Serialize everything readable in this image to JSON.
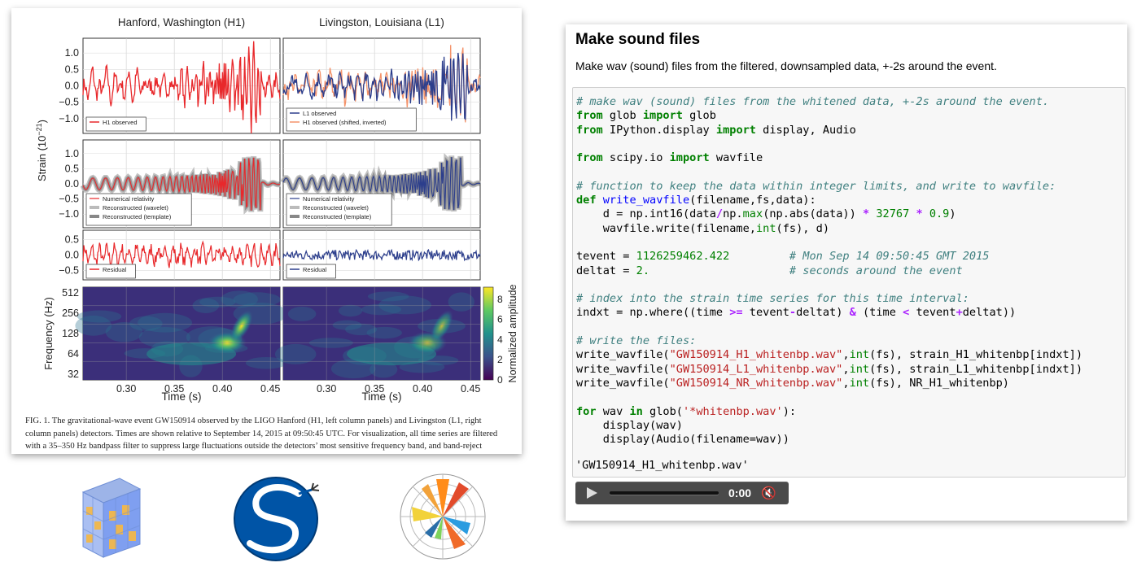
{
  "figure": {
    "titles": [
      "Hanford, Washington (H1)",
      "Livingston, Louisiana (L1)"
    ],
    "ylabel_strain": "Strain (10",
    "ylabel_strain_exp": "−21",
    "ylabel_strain_end": ")",
    "ylabel_freq": "Frequency (Hz)",
    "xlabel": "Time (s)",
    "colorbar_label": "Normalized amplitude",
    "yticks_top": [
      "1.0",
      "0.5",
      "0.0",
      "−0.5",
      "−1.0"
    ],
    "yticks_mid": [
      "1.0",
      "0.5",
      "0.0",
      "−0.5",
      "−1.0"
    ],
    "yticks_res": [
      "0.5",
      "0.0",
      "−0.5"
    ],
    "yticks_freq": [
      "512",
      "256",
      "128",
      "64",
      "32"
    ],
    "xticks": [
      "0.30",
      "0.35",
      "0.40",
      "0.45"
    ],
    "cbar_ticks": [
      "8",
      "6",
      "4",
      "2",
      "0"
    ],
    "legend_h1_top": [
      "H1 observed"
    ],
    "legend_l1_top": [
      "L1 observed",
      "H1 observed (shifted, inverted)"
    ],
    "legend_mid": [
      "Numerical relativity",
      "Reconstructed (wavelet)",
      "Reconstructed (template)"
    ],
    "legend_res": [
      "Residual"
    ],
    "caption_lines": [
      "FIG. 1.   The gravitational-wave event GW150914 observed by the LIGO Hanford (H1, left column panels) and Livingston (L1, right",
      "column panels) detectors. Times are shown relative to September 14, 2015 at 09:50:45 UTC. For visualization, all time series are filtered",
      "with a 35–350 Hz bandpass filter to suppress large fluctuations outside the detectors’ most sensitive frequency band, and band-reject"
    ],
    "colors": {
      "h1": "#e8282b",
      "l1": "#2c3e8c",
      "l1_overlay": "#f4936a"
    }
  },
  "notebook": {
    "heading": "Make sound files",
    "description": "Make wav (sound) files from the filtered, downsampled data, +-2s around the event.",
    "code_lines": [
      "# make wav (sound) files from the whitened data, +-2s around the event.",
      "from glob import glob",
      "from IPython.display import display, Audio",
      "",
      "from scipy.io import wavfile",
      "",
      "# function to keep the data within integer limits, and write to wavfile:",
      "def write_wavfile(filename,fs,data):",
      "    d = np.int16(data/np.max(np.abs(data)) * 32767 * 0.9)",
      "    wavfile.write(filename,int(fs), d)",
      "",
      "tevent = 1126259462.422         # Mon Sep 14 09:50:45 GMT 2015",
      "deltat = 2.                     # seconds around the event",
      "",
      "# index into the strain time series for this time interval:",
      "indxt = np.where((time >= tevent-deltat) & (time < tevent+deltat))",
      "",
      "# write the files:",
      "write_wavfile(\"GW150914_H1_whitenbp.wav\",int(fs), strain_H1_whitenbp[indxt])",
      "write_wavfile(\"GW150914_L1_whitenbp.wav\",int(fs), strain_L1_whitenbp[indxt])",
      "write_wavfile(\"GW150914_NR_whitenbp.wav\",int(fs), NR_H1_whitenbp)",
      "",
      "for wav in glob('*whitenbp.wav'):",
      "    display(wav)",
      "    display(Audio(filename=wav))"
    ],
    "output_text": "'GW150914_H1_whitenbp.wav'",
    "player": {
      "time": "0:00",
      "play_icon": "play-icon",
      "mute_icon": "mute-icon"
    }
  },
  "logos": [
    "numpy-cube-logo",
    "scipy-logo",
    "matplotlib-polar-logo"
  ]
}
